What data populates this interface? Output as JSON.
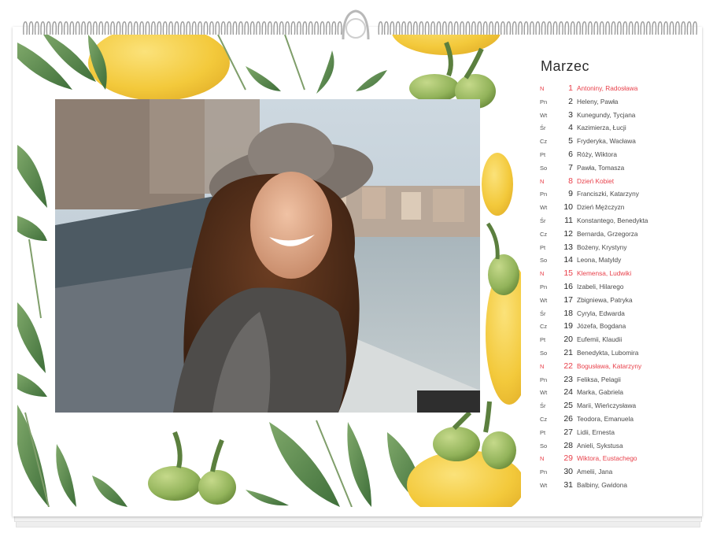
{
  "calendar": {
    "month": "Marzec",
    "days": [
      {
        "dow": "N",
        "day": "1",
        "names": "Antoniny, Radosława",
        "red": true
      },
      {
        "dow": "Pn",
        "day": "2",
        "names": "Heleny, Pawła",
        "red": false
      },
      {
        "dow": "Wt",
        "day": "3",
        "names": "Kunegundy, Tycjana",
        "red": false
      },
      {
        "dow": "Śr",
        "day": "4",
        "names": "Kazimierza, Łucji",
        "red": false
      },
      {
        "dow": "Cz",
        "day": "5",
        "names": "Fryderyka, Wacława",
        "red": false
      },
      {
        "dow": "Pt",
        "day": "6",
        "names": "Róży, Wiktora",
        "red": false
      },
      {
        "dow": "So",
        "day": "7",
        "names": "Pawła, Tomasza",
        "red": false
      },
      {
        "dow": "N",
        "day": "8",
        "names": "Dzień Kobiet",
        "red": true
      },
      {
        "dow": "Pn",
        "day": "9",
        "names": "Franciszki, Katarzyny",
        "red": false
      },
      {
        "dow": "Wt",
        "day": "10",
        "names": "Dzień Mężczyzn",
        "red": false
      },
      {
        "dow": "Śr",
        "day": "11",
        "names": "Konstantego, Benedykta",
        "red": false
      },
      {
        "dow": "Cz",
        "day": "12",
        "names": "Bernarda, Grzegorza",
        "red": false
      },
      {
        "dow": "Pt",
        "day": "13",
        "names": "Bożeny, Krystyny",
        "red": false
      },
      {
        "dow": "So",
        "day": "14",
        "names": "Leona, Matyldy",
        "red": false
      },
      {
        "dow": "N",
        "day": "15",
        "names": "Klemensa, Ludwiki",
        "red": true
      },
      {
        "dow": "Pn",
        "day": "16",
        "names": "Izabeli, Hilarego",
        "red": false
      },
      {
        "dow": "Wt",
        "day": "17",
        "names": "Zbigniewa, Patryka",
        "red": false
      },
      {
        "dow": "Śr",
        "day": "18",
        "names": "Cyryla, Edwarda",
        "red": false
      },
      {
        "dow": "Cz",
        "day": "19",
        "names": "Józefa, Bogdana",
        "red": false
      },
      {
        "dow": "Pt",
        "day": "20",
        "names": "Eufemii, Klaudii",
        "red": false
      },
      {
        "dow": "So",
        "day": "21",
        "names": "Benedykta, Lubomira",
        "red": false
      },
      {
        "dow": "N",
        "day": "22",
        "names": "Bogusława, Katarzyny",
        "red": true
      },
      {
        "dow": "Pn",
        "day": "23",
        "names": "Feliksa, Pelagii",
        "red": false
      },
      {
        "dow": "Wt",
        "day": "24",
        "names": "Marka, Gabriela",
        "red": false
      },
      {
        "dow": "Śr",
        "day": "25",
        "names": "Marii, Wieńczysława",
        "red": false
      },
      {
        "dow": "Cz",
        "day": "26",
        "names": "Teodora, Emanuela",
        "red": false
      },
      {
        "dow": "Pt",
        "day": "27",
        "names": "Lidii, Ernesta",
        "red": false
      },
      {
        "dow": "So",
        "day": "28",
        "names": "Anieli, Sykstusa",
        "red": false
      },
      {
        "dow": "N",
        "day": "29",
        "names": "Wiktora, Eustachego",
        "red": true
      },
      {
        "dow": "Pn",
        "day": "30",
        "names": "Amelii, Jana",
        "red": false
      },
      {
        "dow": "Wt",
        "day": "31",
        "names": "Balbiny, Gwidona",
        "red": false
      }
    ]
  },
  "colors": {
    "sunday_red": "#e8414b",
    "lemon": "#f5cf4a",
    "olive": "#8fae5a",
    "leaf": "#5f8f4e"
  },
  "icons": {
    "binding": "spiral-binding-icon",
    "hanger": "hanger-hook-icon"
  }
}
